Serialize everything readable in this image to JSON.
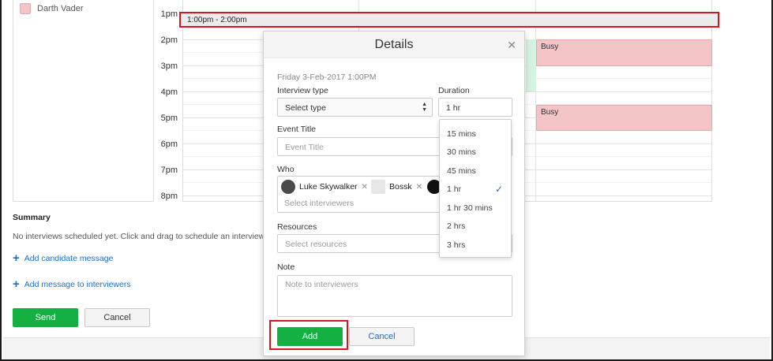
{
  "calendar": {
    "attendee_name": "Darth Vader",
    "attendee_color": "#f4c5c7",
    "time_labels": [
      "1pm",
      "2pm",
      "3pm",
      "4pm",
      "5pm",
      "6pm",
      "7pm",
      "8pm"
    ],
    "selection_label": "1:00pm - 2:00pm",
    "busy_label": "Busy",
    "busy_color": "#f4c5c7",
    "selection_highlight_color": "#d0191f"
  },
  "summary": {
    "title": "Summary",
    "text": "No interviews scheduled yet. Click and drag to schedule an interview",
    "add_candidate_message": "Add candidate message",
    "add_interviewer_message": "Add message to interviewers",
    "send_label": "Send",
    "cancel_label": "Cancel"
  },
  "modal": {
    "title": "Details",
    "close_icon": "close-icon",
    "date_text": "Friday 3-Feb-2017 1:00PM",
    "interview_type_label": "Interview type",
    "interview_type_value": "Select type",
    "duration_label": "Duration",
    "duration_value": "1 hr",
    "event_title_label": "Event Title",
    "event_title_placeholder": "Event Title",
    "who_label": "Who",
    "interviewers": [
      {
        "name": "Luke Skywalker"
      },
      {
        "name": "Bossk"
      }
    ],
    "who_placeholder": "Select interviewers",
    "resources_label": "Resources",
    "resources_placeholder": "Select resources",
    "note_label": "Note",
    "note_placeholder": "Note to interviewers",
    "add_label": "Add",
    "cancel_label": "Cancel",
    "accent_color": "#15b042"
  },
  "duration_options": [
    "15 mins",
    "30 mins",
    "45 mins",
    "1 hr",
    "1 hr 30 mins",
    "2 hrs",
    "3 hrs"
  ],
  "duration_selected": "1 hr"
}
